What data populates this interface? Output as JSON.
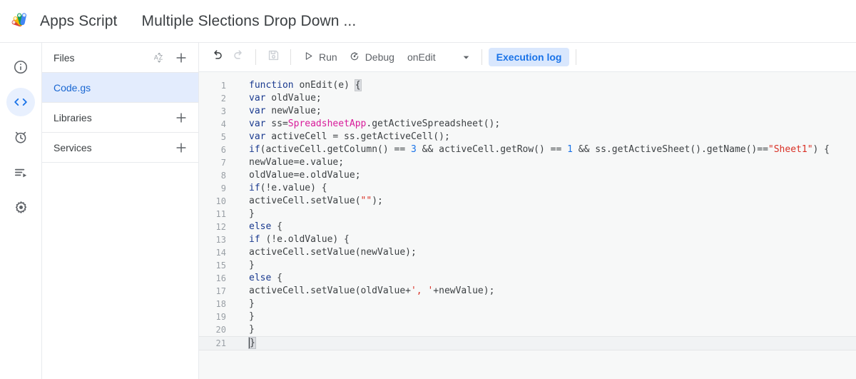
{
  "header": {
    "logo_icon": "apps-script-logo",
    "brand": "Apps Script",
    "project_title": "Multiple Slections Drop Down ...",
    "logo_colors": [
      "#f4b400",
      "#0f9d58",
      "#4285f4",
      "#db4437"
    ]
  },
  "icon_rail": {
    "items": [
      {
        "name": "overview",
        "icon": "info-circle-icon",
        "active": false
      },
      {
        "name": "editor",
        "icon": "code-brackets-icon",
        "active": true
      },
      {
        "name": "triggers",
        "icon": "alarm-clock-icon",
        "active": false
      },
      {
        "name": "executions",
        "icon": "executions-list-icon",
        "active": false
      },
      {
        "name": "project-settings",
        "icon": "gear-icon",
        "active": false
      }
    ],
    "active_color": "#e8f0fe",
    "active_icon_color": "#1a73e8"
  },
  "files_panel": {
    "files_header": {
      "label": "Files",
      "sort_icon": "sort-az-icon",
      "add_icon": "plus-icon"
    },
    "files": [
      {
        "name": "Code.gs",
        "selected": true
      }
    ],
    "libraries_header": {
      "label": "Libraries",
      "add_icon": "plus-icon"
    },
    "services_header": {
      "label": "Services",
      "add_icon": "plus-icon"
    },
    "selected_bg": "#e3ecfd",
    "selected_fg": "#1967d2"
  },
  "toolbar": {
    "undo": {
      "label": "Undo",
      "icon": "undo-icon",
      "enabled": true
    },
    "redo": {
      "label": "Redo",
      "icon": "redo-icon",
      "enabled": false
    },
    "save": {
      "label": "Save project",
      "icon": "save-floppy-icon",
      "enabled": false
    },
    "run": {
      "label": "Run",
      "icon": "play-triangle-icon"
    },
    "debug": {
      "label": "Debug",
      "icon": "debug-icon"
    },
    "function_select": {
      "value": "onEdit",
      "chevron_icon": "chevron-down-icon"
    },
    "execution_log": {
      "label": "Execution log",
      "bg": "#d9e7fd",
      "fg": "#1a73e8"
    }
  },
  "editor": {
    "language": "javascript",
    "background": "#f7f8f8",
    "active_line": 21,
    "cursor_line": 21,
    "total_lines": 21,
    "colors": {
      "keyword": "#1a3a8f",
      "class": "#d81b9a",
      "number": "#1a73e8",
      "string": "#d93025",
      "text": "#3c4043",
      "gutter": "#9aa0a6"
    },
    "lines": [
      {
        "n": 1,
        "text": "function onEdit(e) {"
      },
      {
        "n": 2,
        "text": "var oldValue;"
      },
      {
        "n": 3,
        "text": "var newValue;"
      },
      {
        "n": 4,
        "text": "var ss=SpreadsheetApp.getActiveSpreadsheet();"
      },
      {
        "n": 5,
        "text": "var activeCell = ss.getActiveCell();"
      },
      {
        "n": 6,
        "text": "if(activeCell.getColumn() == 3 && activeCell.getRow() == 1 && ss.getActiveSheet().getName()==\"Sheet1\") {"
      },
      {
        "n": 7,
        "text": "newValue=e.value;"
      },
      {
        "n": 8,
        "text": "oldValue=e.oldValue;"
      },
      {
        "n": 9,
        "text": "if(!e.value) {"
      },
      {
        "n": 10,
        "text": "activeCell.setValue(\"\");"
      },
      {
        "n": 11,
        "text": "}"
      },
      {
        "n": 12,
        "text": "else {"
      },
      {
        "n": 13,
        "text": "if (!e.oldValue) {"
      },
      {
        "n": 14,
        "text": "activeCell.setValue(newValue);"
      },
      {
        "n": 15,
        "text": "}"
      },
      {
        "n": 16,
        "text": "else {"
      },
      {
        "n": 17,
        "text": "activeCell.setValue(oldValue+', '+newValue);"
      },
      {
        "n": 18,
        "text": "}"
      },
      {
        "n": 19,
        "text": "}"
      },
      {
        "n": 20,
        "text": "}"
      },
      {
        "n": 21,
        "text": "}"
      }
    ]
  }
}
